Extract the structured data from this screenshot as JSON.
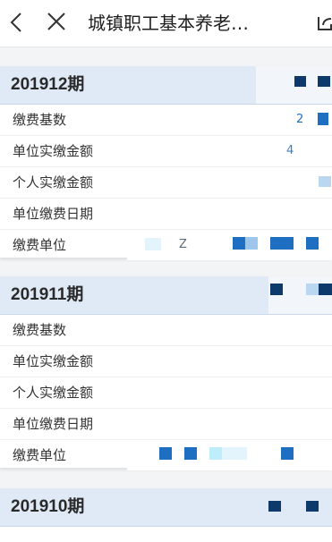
{
  "nav": {
    "title": "城镇职工基本养老…"
  },
  "labels": {
    "base": "缴费基数",
    "unit_paid": "单位实缴金额",
    "personal_paid": "个人实缴金额",
    "unit_date": "单位缴费日期",
    "unit": "缴费单位"
  },
  "records": [
    {
      "period": "201912期",
      "partial_digits": [
        "2",
        "4",
        "Z"
      ]
    },
    {
      "period": "201911期"
    },
    {
      "period": "201910期"
    }
  ],
  "colors": {
    "header_bg": "#dfeaf6",
    "accent_blue": "#1e6fc2",
    "dark_blue": "#0d3a6b"
  }
}
